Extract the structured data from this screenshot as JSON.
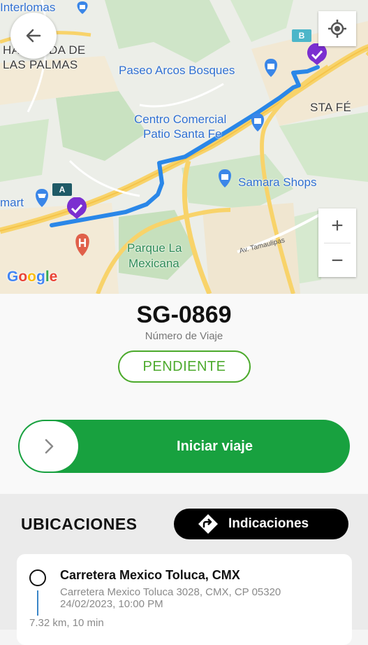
{
  "map": {
    "labels": {
      "interlomas": "Interlomas",
      "hacienda": "HACIENDA DE",
      "palmas": "LAS PALMAS",
      "paseo": "Paseo Arcos Bosques",
      "santafe": "STA FÉ",
      "centro1": "Centro Comercial",
      "centro2": "Patio Santa Fe",
      "samara": "Samara Shops",
      "mart": "mart",
      "parque1": "Parque La",
      "parque2": "Mexicana",
      "street": "Av. Tamaulipas"
    },
    "marker_a": "A",
    "marker_b": "B",
    "zoom_in": "+",
    "zoom_out": "−",
    "attribution": "Google",
    "colors": {
      "route": "#2a87e8",
      "marker_purple": "#7b2fd0",
      "marker_badge": "#1f5a66"
    }
  },
  "trip": {
    "number": "SG-0869",
    "number_label": "Número de Viaje",
    "status": "PENDIENTE",
    "start_label": "Iniciar viaje",
    "colors": {
      "status": "#4caa2c",
      "slider": "#18a13f"
    }
  },
  "locations": {
    "title": "UBICACIONES",
    "directions_label": "Indicaciones",
    "items": [
      {
        "name": "Carretera Mexico Toluca, CMX",
        "address": "Carretera Mexico Toluca 3028, CMX, CP 05320",
        "datetime": "24/02/2023, 10:00 PM",
        "distance": "7.32 km, 10 min"
      }
    ]
  }
}
